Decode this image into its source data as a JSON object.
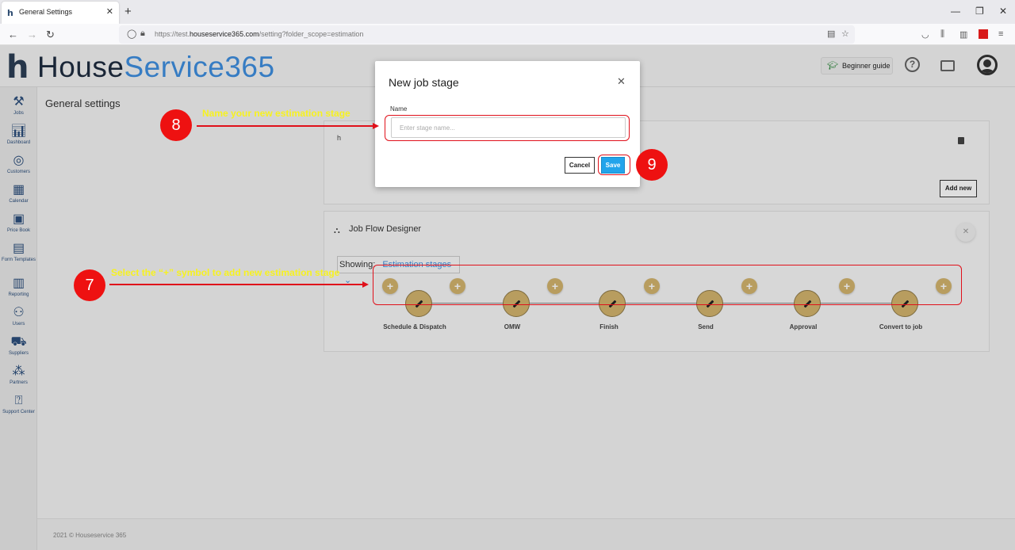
{
  "browser": {
    "tab_title": "General Settings",
    "url_prefix": "https://test.",
    "url_domain": "houseservice365.com",
    "url_path": "/setting?folder_scope=estimation"
  },
  "app": {
    "logo_h": "h",
    "logo_part1": "House",
    "logo_part2": "Service365",
    "beginner_guide": "Beginner guide",
    "help_symbol": "?"
  },
  "sidebar": {
    "items": [
      {
        "label": "Jobs",
        "icon": "tools-icon"
      },
      {
        "label": "Dashboard",
        "icon": "dashboard-icon"
      },
      {
        "label": "Customers",
        "icon": "customers-icon"
      },
      {
        "label": "Calendar",
        "icon": "calendar-icon"
      },
      {
        "label": "Price Book",
        "icon": "pricebook-icon"
      },
      {
        "label": "Form Templates",
        "icon": "form-icon"
      },
      {
        "label": "Reporting",
        "icon": "reporting-icon"
      },
      {
        "label": "Users",
        "icon": "users-icon"
      },
      {
        "label": "Suppliers",
        "icon": "truck-icon"
      },
      {
        "label": "Partners",
        "icon": "partners-icon"
      },
      {
        "label": "Support Center",
        "icon": "support-icon"
      }
    ]
  },
  "page": {
    "title": "General settings"
  },
  "card1": {
    "text": "h",
    "add_new": "Add new"
  },
  "flow": {
    "title": "Job Flow Designer",
    "showing_label": "Showing:",
    "showing_value": "Estimation stages",
    "plus_symbol": "+",
    "stages": [
      "Schedule & Dispatch",
      "OMW",
      "Finish",
      "Send",
      "Approval",
      "Convert to job"
    ]
  },
  "footer": {
    "copyright": "2021 © Houseservice 365"
  },
  "modal": {
    "title": "New job stage",
    "name_label": "Name",
    "name_placeholder": "Enter stage name...",
    "name_value": "",
    "cancel": "Cancel",
    "save": "Save"
  },
  "annotations": {
    "step7_number": "7",
    "step7_text": "Select the “+” symbol to add new estimation stage",
    "step8_number": "8",
    "step8_text": "Name your new estimation stage",
    "step9_number": "9"
  },
  "colors": {
    "annotation_red": "#e0101a",
    "annotation_yellow": "#f7f21f",
    "save_blue": "#22a4eb",
    "stage_gold": "#d4b56e",
    "brand_blue": "#3e8fe0"
  }
}
